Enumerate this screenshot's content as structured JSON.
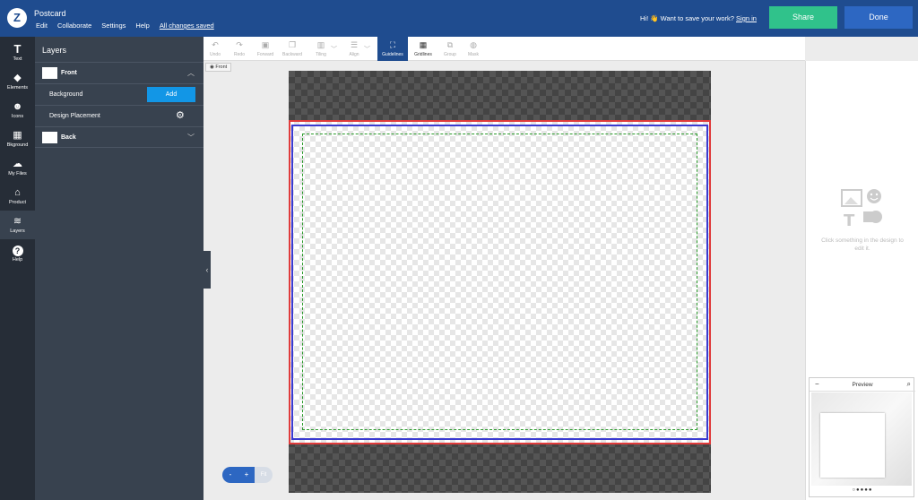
{
  "header": {
    "logo": "Z",
    "title": "Postcard",
    "menu": [
      "Edit",
      "Collaborate",
      "Settings",
      "Help"
    ],
    "saved_status": "All changes saved",
    "save_prompt": "Hi! 👋 Want to save your work?",
    "signin": "Sign in",
    "share": "Share",
    "done": "Done"
  },
  "rail": [
    {
      "label": "Text",
      "icon": "T"
    },
    {
      "label": "Elements",
      "icon": "◆"
    },
    {
      "label": "Icons",
      "icon": "☻"
    },
    {
      "label": "Bkground",
      "icon": "▦"
    },
    {
      "label": "My Files",
      "icon": "☁"
    },
    {
      "label": "Product",
      "icon": "⌂"
    },
    {
      "label": "Layers",
      "icon": "≋"
    },
    {
      "label": "Help",
      "icon": "?"
    }
  ],
  "layers": {
    "title": "Layers",
    "front": "Front",
    "background": "Background",
    "add": "Add",
    "design_placement": "Design Placement",
    "back": "Back"
  },
  "toolbar": {
    "undo": "Undo",
    "redo": "Redo",
    "forward": "Forward",
    "backward": "Backward",
    "tiling": "Tiling",
    "align": "Align",
    "guidelines": "Guidelines",
    "gridlines": "Gridlines",
    "group": "Group",
    "mask": "Mask"
  },
  "canvas": {
    "side_chip": "Front"
  },
  "zoom": {
    "minus": "-",
    "plus": "+",
    "fit": "Fit"
  },
  "right_panel": {
    "empty_text": "Click something in the design to edit it."
  },
  "preview": {
    "title": "Preview",
    "dots": "○●●●●"
  },
  "colors": {
    "header_bg": "#1f4c8f",
    "share": "#30c28b",
    "done": "#2d67c2",
    "add": "#1296e6",
    "bleed": "#e03b3b",
    "trim": "#3a3ad0",
    "safe": "#2a9a2a"
  }
}
